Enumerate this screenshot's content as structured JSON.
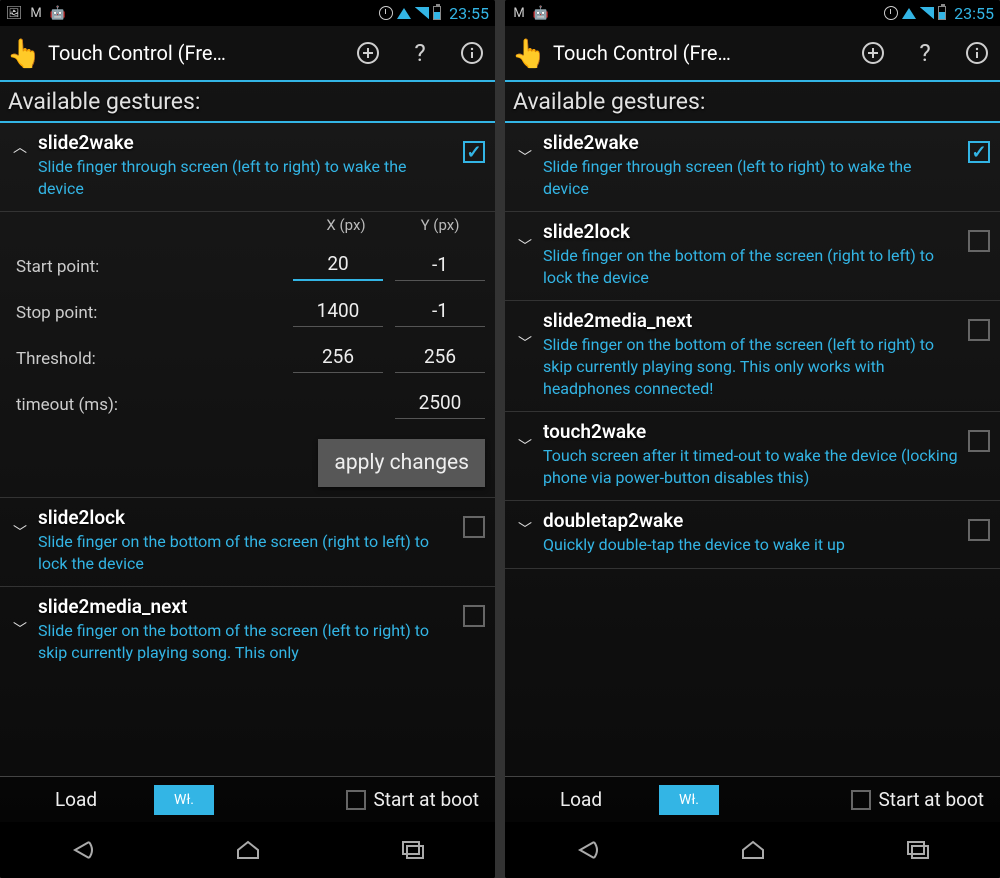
{
  "status": {
    "clock": "23:55"
  },
  "actionbar": {
    "title": "Touch Control (Fre…"
  },
  "section_header": "Available gestures:",
  "left": {
    "g0": {
      "title": "slide2wake",
      "desc": "Slide finger through screen (left to right) to wake the device"
    },
    "params": {
      "x_header": "X (px)",
      "y_header": "Y (px)",
      "start_label": "Start point:",
      "start_x": "20",
      "start_y": "-1",
      "stop_label": "Stop point:",
      "stop_x": "1400",
      "stop_y": "-1",
      "threshold_label": "Threshold:",
      "threshold_x": "256",
      "threshold_y": "256",
      "timeout_label": "timeout (ms):",
      "timeout": "2500",
      "apply": "apply changes"
    },
    "g1": {
      "title": "slide2lock",
      "desc": "Slide finger on the bottom of the screen (right to left) to lock the device"
    },
    "g2": {
      "title": "slide2media_next",
      "desc": "Slide finger on the bottom of the screen (left to right) to skip currently playing song. This only"
    }
  },
  "right": {
    "g0": {
      "title": "slide2wake",
      "desc": "Slide finger through screen (left to right) to wake the device"
    },
    "g1": {
      "title": "slide2lock",
      "desc": "Slide finger on the bottom of the screen (right to left) to lock the device"
    },
    "g2": {
      "title": "slide2media_next",
      "desc": "Slide finger on the bottom of the screen (left to right) to skip currently playing song. This only works with headphones connected!"
    },
    "g3": {
      "title": "touch2wake",
      "desc": "Touch screen after it timed-out to wake the device (locking phone via power-button disables this)"
    },
    "g4": {
      "title": "doubletap2wake",
      "desc": "Quickly double-tap the device to wake it up"
    }
  },
  "bottom": {
    "load": "Load",
    "toggle": "Wł.",
    "start_at_boot": "Start at boot"
  }
}
